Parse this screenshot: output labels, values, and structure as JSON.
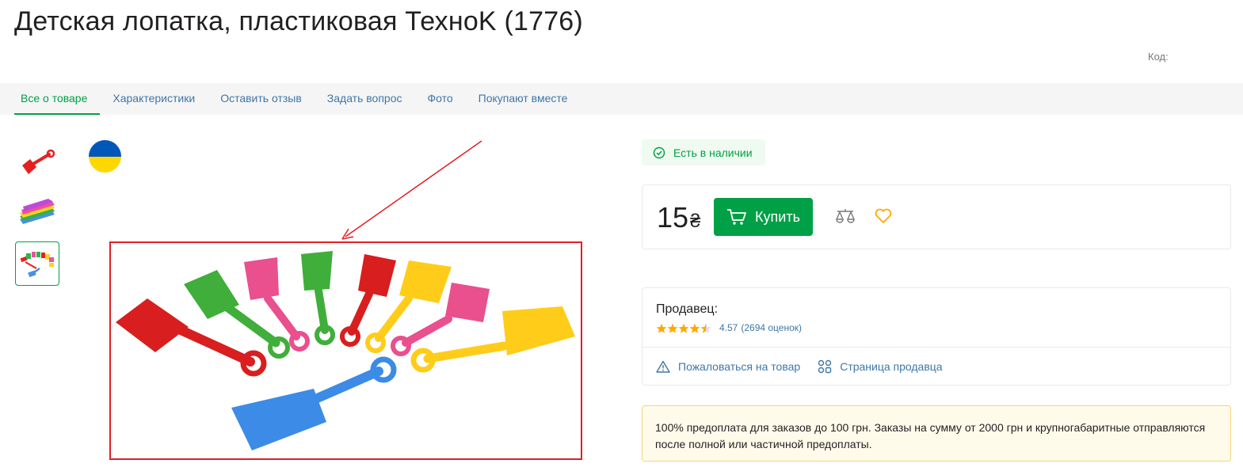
{
  "product": {
    "title": "Детская лопатка, пластиковая ТехноK (1776)",
    "code_label": "Код:"
  },
  "tabs": [
    {
      "label": "Все о товаре",
      "active": true
    },
    {
      "label": "Характеристики"
    },
    {
      "label": "Оставить отзыв"
    },
    {
      "label": "Задать вопрос"
    },
    {
      "label": "Фото"
    },
    {
      "label": "Покупают вместе"
    }
  ],
  "gallery": {
    "thumbnails": [
      "red-shovel-thumb",
      "stacked-shovels-thumb",
      "shovels-fan-thumb"
    ],
    "active_thumbnail": 2,
    "flag": "ukraine-flag"
  },
  "availability": {
    "label": "Есть в наличии",
    "icon": "check-circle-icon"
  },
  "purchase": {
    "price": "15",
    "currency": "₴",
    "buy_label": "Купить"
  },
  "seller": {
    "label": "Продавец:",
    "rating_value": "4.57",
    "rating_count": "(2694 оценок)",
    "stars": 4.5,
    "complain_label": "Пожаловаться на товар",
    "page_label": "Страница продавца"
  },
  "notice": {
    "text": "100% предоплата для заказов до 100 грн. Заказы на сумму от 2000 грн и крупногабаритные отправляются после полной или частичной предоплаты."
  },
  "colors": {
    "accent_green": "#00a046",
    "link_blue": "#3e77aa",
    "highlight_red": "#e31e24",
    "star_orange": "#ffa900"
  }
}
